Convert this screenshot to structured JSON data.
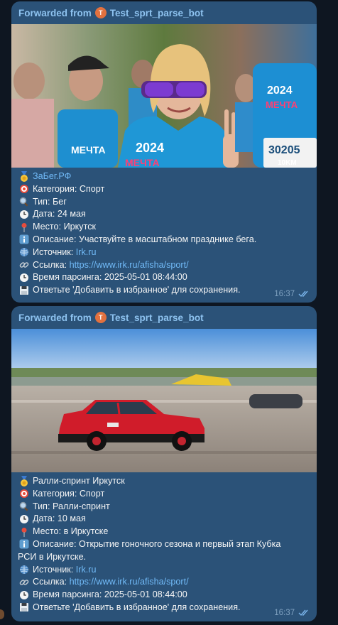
{
  "messages": [
    {
      "forwarded_prefix": "Forwarded from",
      "bot_initial": "T",
      "bot_name": "Test_sprt_parse_bot",
      "title": "ЗаБег.РФ",
      "category_label": "Категория:",
      "category_value": "Спорт",
      "type_label": "Тип:",
      "type_value": "Бег",
      "date_label": "Дата:",
      "date_value": "24 мая",
      "place_label": "Место:",
      "place_value": "Иркутск",
      "desc_label": "Описание:",
      "desc_value": "Участвуйте в масштабном празднике бега.",
      "source_label": "Источник:",
      "source_value": "Irk.ru",
      "link_label": "Ссылка:",
      "link_value": "https://www.irk.ru/afisha/sport/",
      "parse_label": "Время парсинга:",
      "parse_value": "2025-05-01 08:44:00",
      "reply_hint": "Ответьте 'Добавить в избранное' для сохранения.",
      "time": "16:37"
    },
    {
      "forwarded_prefix": "Forwarded from",
      "bot_initial": "T",
      "bot_name": "Test_sprt_parse_bot",
      "title": "Ралли-спринт Иркутск",
      "category_label": "Категория:",
      "category_value": "Спорт",
      "type_label": "Тип:",
      "type_value": "Ралли-спринт",
      "date_label": "Дата:",
      "date_value": "10 мая",
      "place_label": "Место:",
      "place_value": "в Иркутске",
      "desc_label": "Описание:",
      "desc_value": "Открытие гоночного сезона и первый этап Кубка",
      "desc_value_cont": "РСИ в Иркутске.",
      "source_label": "Источник:",
      "source_value": "Irk.ru",
      "link_label": "Ссылка:",
      "link_value": "https://www.irk.ru/afisha/sport/",
      "parse_label": "Время парсинга:",
      "parse_value": "2025-05-01 08:44:00",
      "reply_hint": "Ответьте 'Добавить в избранное' для сохранения.",
      "time": "16:37"
    }
  ],
  "colors": {
    "chat_bg": "#0e1621",
    "bubble_bg": "#2b5278",
    "forward_header": "#8ec3f0",
    "link": "#71baf7",
    "meta_text": "#7fa1c0"
  },
  "icons": {
    "title": "medal-icon",
    "category": "target-icon",
    "type": "magnifier-icon",
    "date": "clock-icon",
    "place": "pin-icon",
    "description": "info-icon",
    "source": "globe-icon",
    "link": "chain-link-icon",
    "parse_time": "clock-icon",
    "reply": "floppy-disk-icon",
    "read_status": "double-check-icon"
  }
}
